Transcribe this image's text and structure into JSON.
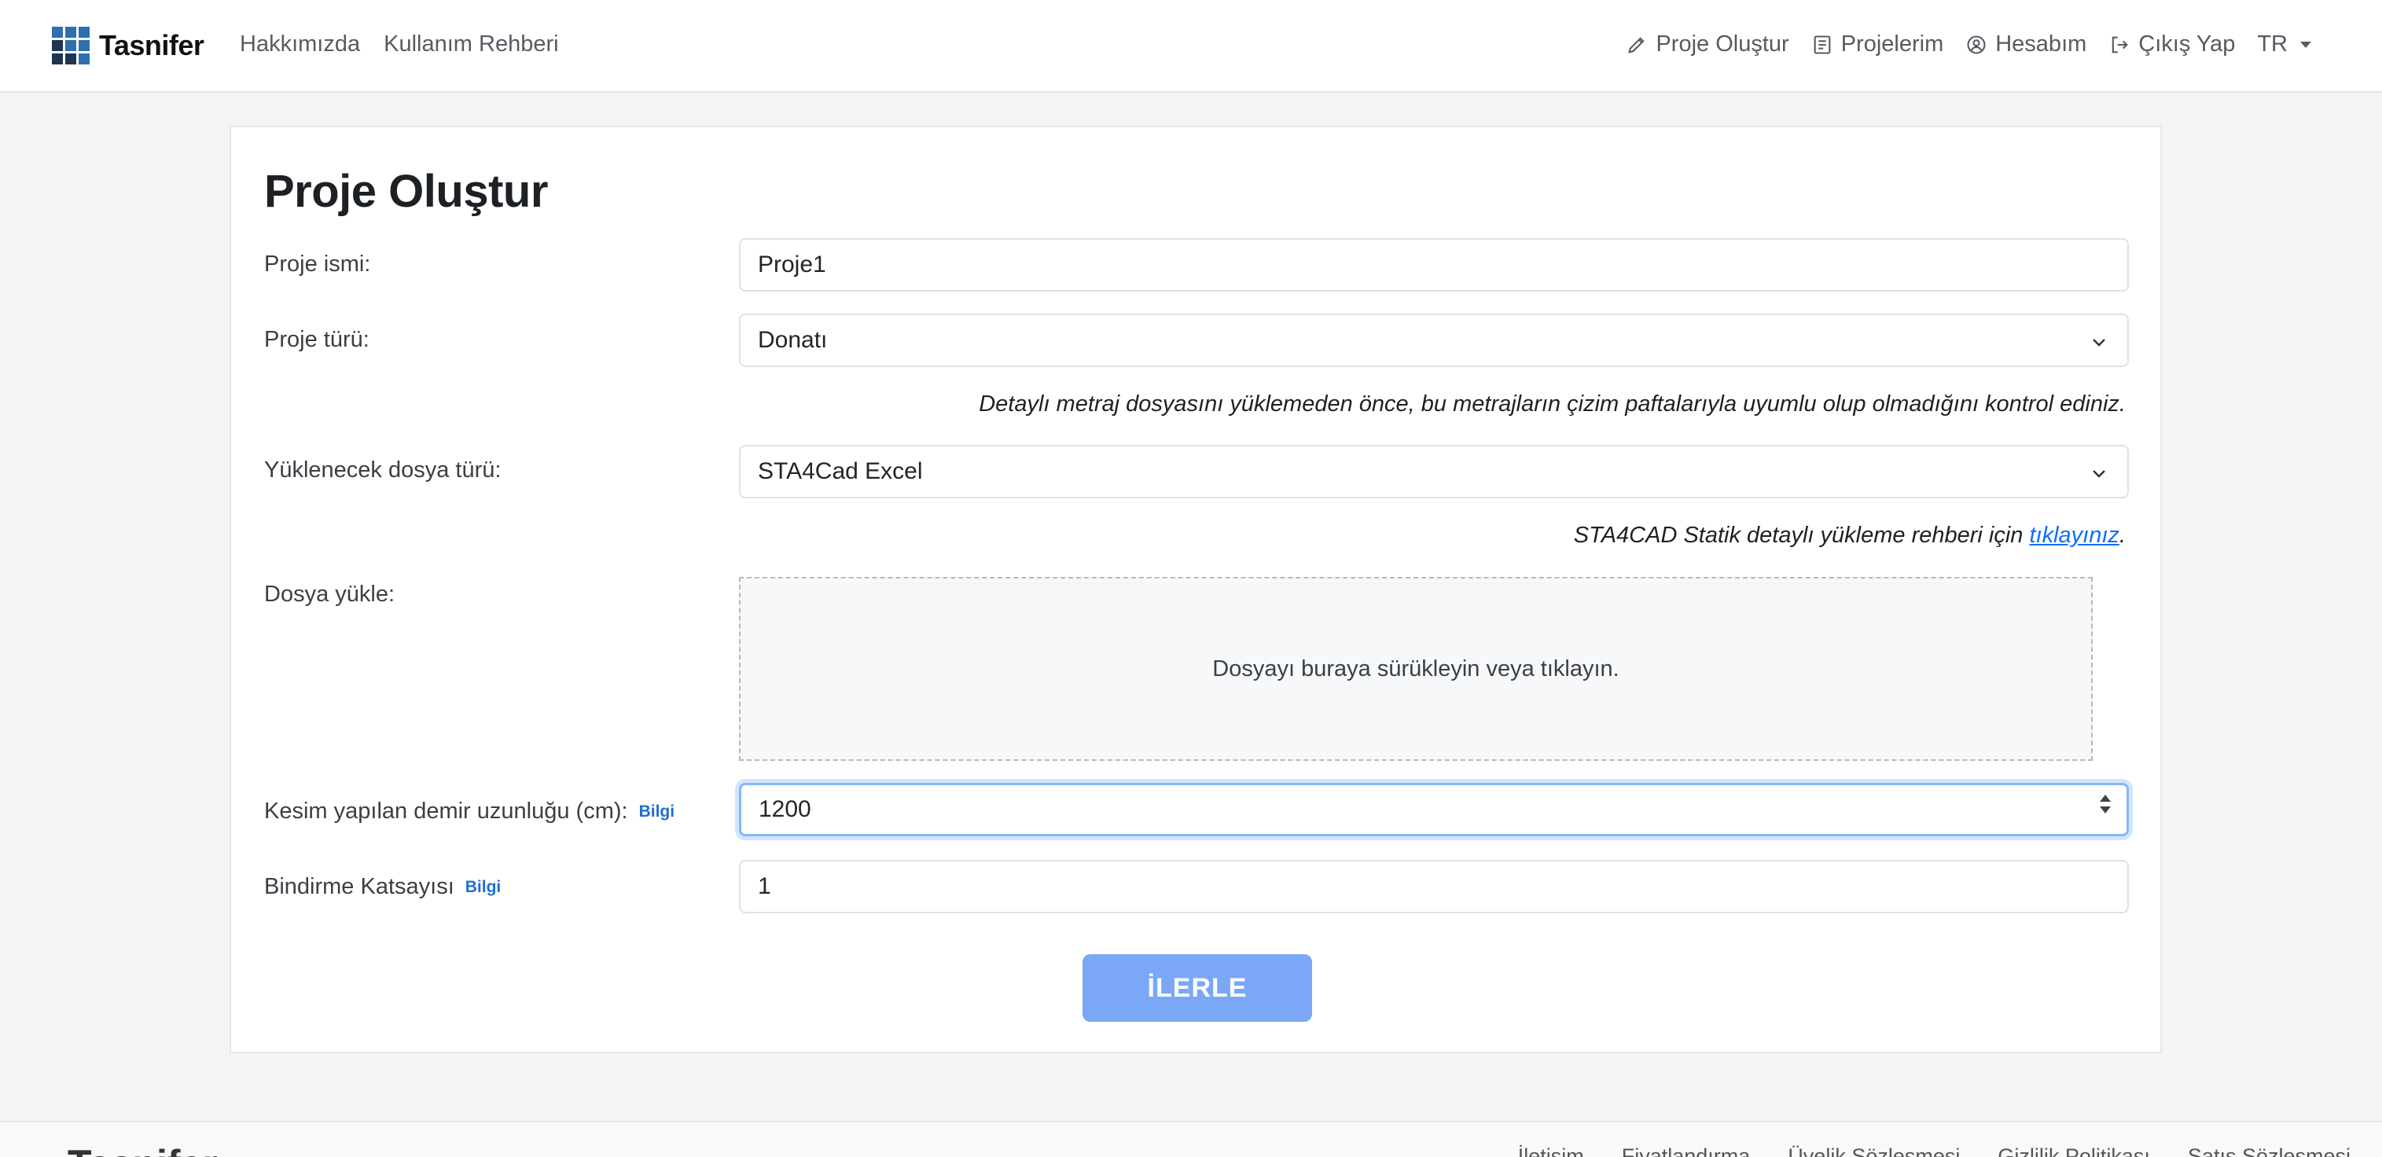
{
  "navbar": {
    "brand": "Tasnifer",
    "left_links": [
      "Hakkımızda",
      "Kullanım Rehberi"
    ],
    "right_items": [
      {
        "label": "Proje Oluştur",
        "icon": "pencil-icon"
      },
      {
        "label": "Projelerim",
        "icon": "document-list-icon"
      },
      {
        "label": "Hesabım",
        "icon": "user-circle-icon"
      },
      {
        "label": "Çıkış Yap",
        "icon": "logout-icon"
      }
    ],
    "language": "TR"
  },
  "form": {
    "title": "Proje Oluştur",
    "project_name_label": "Proje ismi:",
    "project_name_value": "Proje1",
    "project_type_label": "Proje türü:",
    "project_type_value": "Donatı",
    "project_type_note": "Detaylı metraj dosyasını yüklemeden önce, bu metrajların çizim paftalarıyla uyumlu olup olmadığını kontrol ediniz.",
    "file_type_label": "Yüklenecek dosya türü:",
    "file_type_value": "STA4Cad Excel",
    "file_type_note_prefix": "STA4CAD Statik detaylı yükleme rehberi için ",
    "file_type_note_link": "tıklayınız",
    "file_type_note_suffix": ".",
    "upload_label": "Dosya yükle:",
    "upload_hint": "Dosyayı buraya sürükleyin veya tıklayın.",
    "cut_length_label": "Kesim yapılan demir uzunluğu (cm):",
    "cut_length_info": "Bilgi",
    "cut_length_value": "1200",
    "overlap_label": "Bindirme Katsayısı",
    "overlap_info": "Bilgi",
    "overlap_value": "1",
    "submit_label": "İLERLE"
  },
  "footer": {
    "brand": "Tasnifer",
    "links": [
      "İletişim",
      "Fiyatlandırma",
      "Üyelik Sözleşmesi",
      "Gizlilik Politikası",
      "Satış Sözleşmesi"
    ]
  },
  "colors": {
    "primary": "#0d6efd",
    "button": "#7aa8f7",
    "background": "#f3f4f6",
    "brand_blue": "#2f6fb0"
  }
}
